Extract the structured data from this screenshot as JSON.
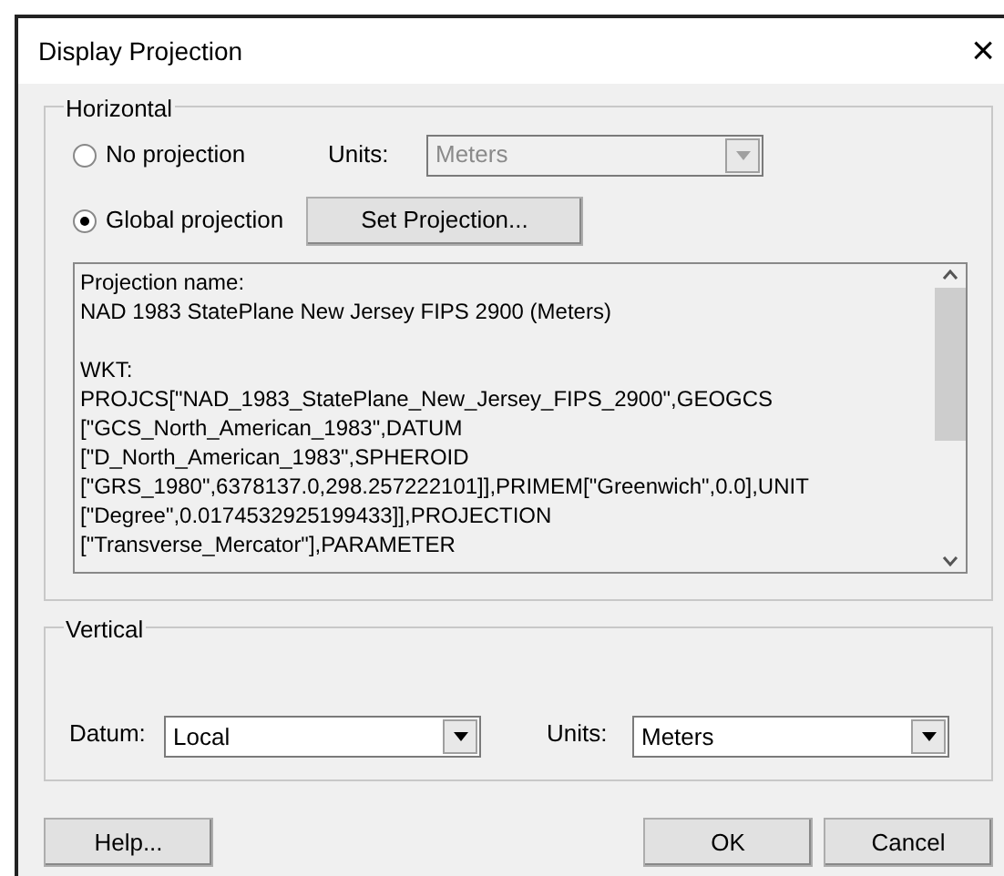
{
  "window": {
    "title": "Display Projection",
    "close": "×"
  },
  "horizontal": {
    "title": "Horizontal",
    "options": [
      {
        "label": "No projection",
        "selected": false
      },
      {
        "label": "Global projection",
        "selected": true
      }
    ],
    "units": {
      "label": "Units:",
      "value": "Meters",
      "disabled": true
    },
    "set_button": "Set Projection...",
    "text_paragraphs": [
      [
        "Projection name:",
        "NAD 1983 StatePlane New Jersey FIPS 2900 (Meters)"
      ],
      [
        "WKT:",
        "PROJCS[\"NAD_1983_StatePlane_New_Jersey_FIPS_2900\",GEOGCS",
        "[\"GCS_North_American_1983\",DATUM",
        "[\"D_North_American_1983\",SPHEROID",
        "[\"GRS_1980\",6378137.0,298.257222101]],PRIMEM[\"Greenwich\",0.0],UNIT",
        "[\"Degree\",0.0174532925199433]],PROJECTION",
        "[\"Transverse_Mercator\"],PARAMETER"
      ]
    ]
  },
  "vertical": {
    "title": "Vertical",
    "datum": {
      "label": "Datum:",
      "value": "Local",
      "disabled": false
    },
    "units": {
      "label": "Units:",
      "value": "Meters",
      "disabled": false
    }
  },
  "buttons": {
    "help": "Help...",
    "ok": "OK",
    "cancel": "Cancel"
  }
}
